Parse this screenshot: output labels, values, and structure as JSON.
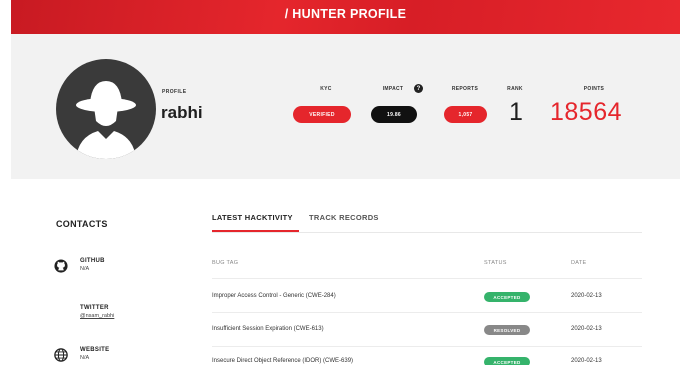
{
  "header": {
    "title": "/ HUNTER PROFILE"
  },
  "profile": {
    "label": "PROFILE",
    "username": "rabhi"
  },
  "stats": {
    "kyc": {
      "label": "KYC",
      "value": "VERIFIED"
    },
    "impact": {
      "label": "IMPACT",
      "value": "19.86",
      "help_icon": "?"
    },
    "reports": {
      "label": "REPORTS",
      "value": "1,057"
    },
    "rank": {
      "label": "RANK",
      "value": "1"
    },
    "points": {
      "label": "POINTS",
      "value": "18564"
    }
  },
  "contacts": {
    "title": "CONTACTS",
    "github": {
      "label": "GITHUB",
      "value": "N/A",
      "icon": "github-icon"
    },
    "twitter": {
      "label": "TWITTER",
      "value": "@nsam_rabhi"
    },
    "website": {
      "label": "WEBSITE",
      "value": "N/A",
      "icon": "globe-icon"
    }
  },
  "tabs": [
    {
      "label": "LATEST HACKTIVITY",
      "active": true
    },
    {
      "label": "TRACK RECORDS",
      "active": false
    }
  ],
  "table": {
    "columns": [
      "BUG TAG",
      "STATUS",
      "DATE"
    ],
    "rows": [
      {
        "bug": "Improper Access Control - Generic (CWE-284)",
        "status": "ACCEPTED",
        "date": "2020-02-13"
      },
      {
        "bug": "Insufficient Session Expiration (CWE-613)",
        "status": "RESOLVED",
        "date": "2020-02-13"
      },
      {
        "bug": "Insecure Direct Object Reference (IDOR) (CWE-639)",
        "status": "ACCEPTED",
        "date": "2020-02-13"
      }
    ]
  },
  "colors": {
    "brand_red": "#e5262c",
    "accepted": "#35b36b",
    "resolved": "#888888",
    "hero_bg": "#f2f2f2"
  }
}
